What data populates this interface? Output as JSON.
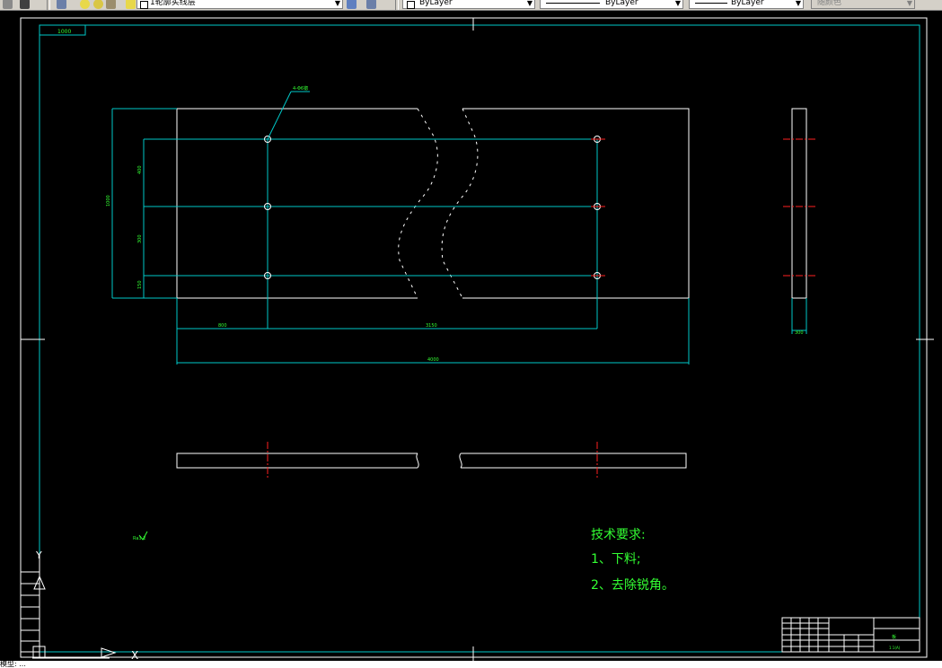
{
  "toolbar": {
    "layer_name": "1轮廓实线层",
    "color_label": "ByLayer",
    "linetype_label": "ByLayer",
    "lineweight_label": "ByLayer",
    "plotstyle_label": "随颜色"
  },
  "drawing": {
    "title_tag": "1000",
    "leader_note": "4-Φ6锪",
    "dims": {
      "left_total": "1000",
      "left_a": "400",
      "left_b": "300",
      "left_c": "150",
      "bottom_a": "800",
      "bottom_b": "3150",
      "bottom_total": "4000",
      "side_width": "300"
    },
    "roughness": "Ra3.2",
    "tech_req": {
      "heading": "技术要求:",
      "item1": "1、下料;",
      "item2": "2、去除锐角。"
    },
    "title_block": {
      "name": "板",
      "sheet": "1:1(A)"
    },
    "axis_y": "Y",
    "axis_x": "X"
  },
  "colors": {
    "frame": "#ffffff",
    "dimension": "#00c8c8",
    "text": "#33ff33",
    "center": "#ff2020",
    "outline": "#ffffff"
  },
  "status": {
    "command_text": "模型: ..."
  }
}
